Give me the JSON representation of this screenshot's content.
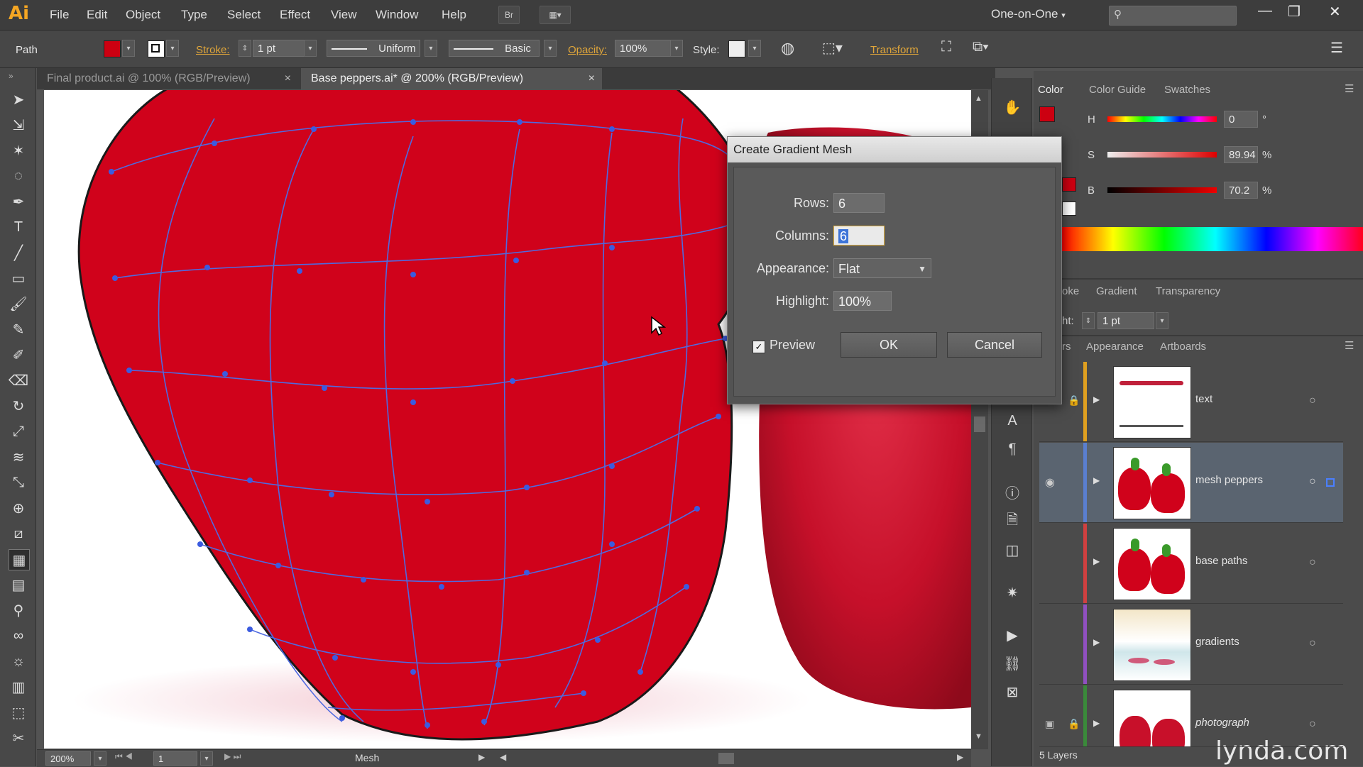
{
  "app": {
    "logo": "Ai"
  },
  "menu": [
    "File",
    "Edit",
    "Object",
    "Type",
    "Select",
    "Effect",
    "View",
    "Window",
    "Help"
  ],
  "menubar": {
    "bridge_label": "Br",
    "workspace": "One-on-One",
    "minimize": "—",
    "restore": "❐",
    "close": "✕"
  },
  "control": {
    "selection_type": "Path",
    "fill_color": "#cc0011",
    "stroke_label": "Stroke:",
    "stroke_weight": "1 pt",
    "profile": "Uniform",
    "brush": "Basic",
    "opacity_label": "Opacity:",
    "opacity_value": "100%",
    "style_label": "Style:",
    "transform_label": "Transform"
  },
  "tabs": [
    {
      "label": "Final product.ai @ 100% (RGB/Preview)",
      "close": "×",
      "active": false
    },
    {
      "label": "Base peppers.ai* @ 200% (RGB/Preview)",
      "close": "×",
      "active": true
    }
  ],
  "status": {
    "zoom": "200%",
    "artboard": "1",
    "tool": "Mesh"
  },
  "color_panel": {
    "tabs": [
      "Color",
      "Color Guide",
      "Swatches"
    ],
    "h_label": "H",
    "h_value": "0",
    "h_unit": "°",
    "s_label": "S",
    "s_value": "89.94",
    "s_unit": "%",
    "b_label": "B",
    "b_value": "70.2",
    "b_unit": "%"
  },
  "stroke_panel": {
    "tabs": [
      "oke",
      "Gradient",
      "Transparency"
    ],
    "weight_label": "ht:",
    "weight": "1 pt"
  },
  "layers_panel": {
    "tabs": [
      "rs",
      "Appearance",
      "Artboards"
    ],
    "layers": [
      {
        "name": "text",
        "color": "#e0a020"
      },
      {
        "name": "mesh peppers",
        "color": "#5a7fd0"
      },
      {
        "name": "base paths",
        "color": "#d04040"
      },
      {
        "name": "gradients",
        "color": "#9050c0"
      },
      {
        "name": "photograph",
        "color": "#3a8a3a"
      }
    ],
    "count": "5 Layers"
  },
  "dialog": {
    "title": "Create Gradient Mesh",
    "rows_label": "Rows:",
    "rows_value": "6",
    "columns_label": "Columns:",
    "columns_value": "6",
    "appearance_label": "Appearance:",
    "appearance_value": "Flat",
    "highlight_label": "Highlight:",
    "highlight_value": "100%",
    "preview_label": "Preview",
    "preview_checked": true,
    "ok_label": "OK",
    "cancel_label": "Cancel"
  },
  "watermark": "lynda.com",
  "icons": [
    "selection-tool-icon",
    "direct-selection-icon",
    "magic-wand-icon",
    "lasso-icon",
    "pen-icon",
    "type-icon",
    "line-icon",
    "rectangle-icon",
    "paintbrush-icon",
    "pencil-icon",
    "blob-brush-icon",
    "eraser-icon",
    "rotate-icon",
    "scale-icon",
    "width-icon",
    "free-transform-icon",
    "shape-builder-icon",
    "perspective-icon",
    "mesh-icon",
    "gradient-icon",
    "eyedropper-icon",
    "blend-icon",
    "symbol-sprayer-icon",
    "graph-icon",
    "artboard-icon",
    "slice-icon"
  ]
}
